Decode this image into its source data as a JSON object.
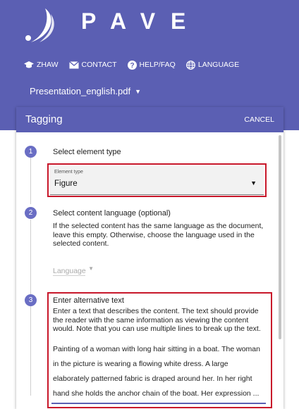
{
  "app": {
    "logo_text": "PAVE"
  },
  "nav": {
    "items": [
      {
        "label": "ZHAW",
        "icon": "graduation-cap-icon"
      },
      {
        "label": "CONTACT",
        "icon": "envelope-icon"
      },
      {
        "label": "HELP/FAQ",
        "icon": "help-icon"
      },
      {
        "label": "LANGUAGE",
        "icon": "globe-icon"
      }
    ]
  },
  "file": {
    "name": "Presentation_english.pdf"
  },
  "panel": {
    "title": "Tagging",
    "cancel_label": "CANCEL",
    "steps": [
      {
        "number": "1",
        "title": "Select element type",
        "field_label": "Element type",
        "field_value": "Figure"
      },
      {
        "number": "2",
        "title": "Select content language (optional)",
        "description": "If the selected content has the same language as the document, leave this empty. Otherwise, choose the language used in the selected content.",
        "field_placeholder": "Language"
      },
      {
        "number": "3",
        "title": "Enter alternative text",
        "description": "Enter a text that describes the content. The text should provide the reader with the same information as viewing the content would. Note that you can use multiple lines to break up the text.",
        "field_value": "Painting of a woman with long hair sitting in a boat. The woman in the picture is wearing a flowing white dress. A large elaborately patterned fabric is draped around her. In her right hand she holds the anchor chain of the boat. Her expression ..."
      }
    ]
  },
  "colors": {
    "primary": "#5b5fb3",
    "step_circle": "#6a6ec4",
    "highlight": "#c8172a"
  }
}
